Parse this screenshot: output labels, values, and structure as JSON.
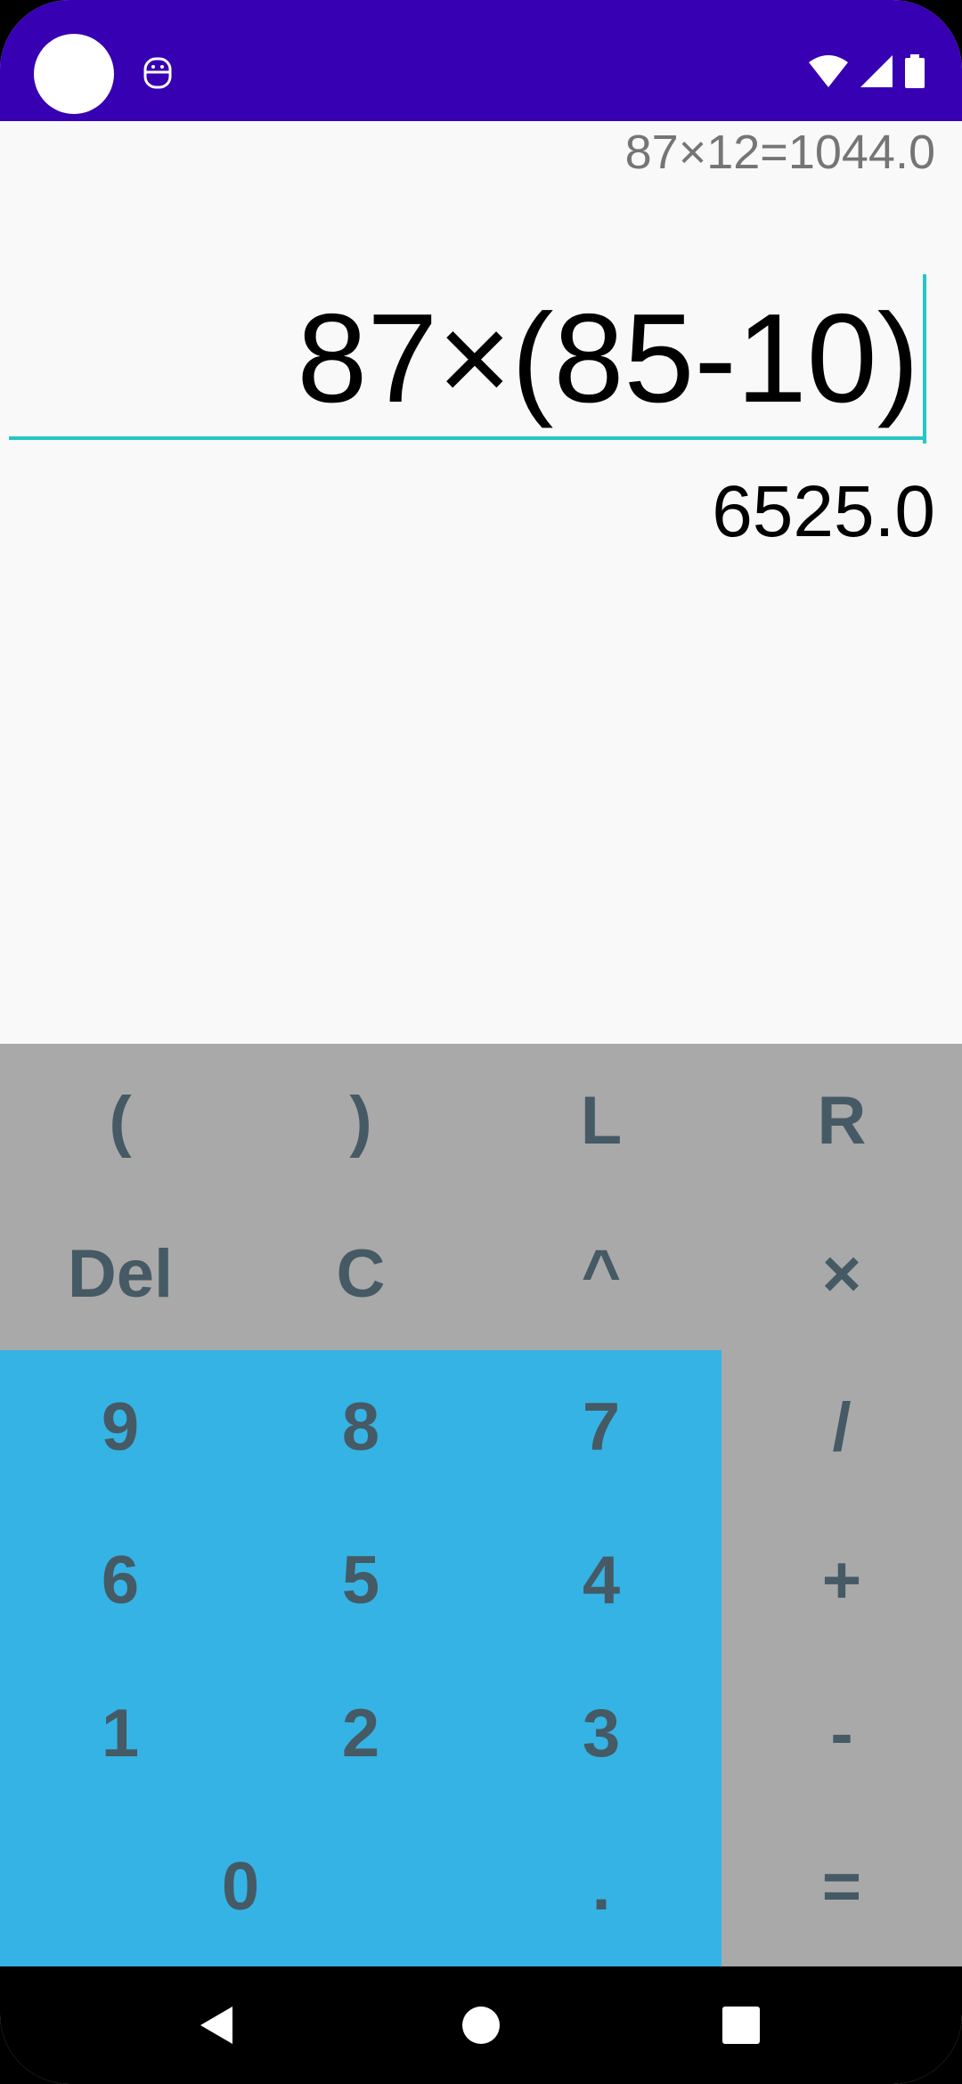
{
  "colors": {
    "status_bar": "#3700b3",
    "display_bg": "#f9f9f9",
    "keypad_bg": "#a9a9a9",
    "numpad_bg": "#35b3e4",
    "key_text": "#455a64",
    "accent": "#26c6c6"
  },
  "status_bar": {
    "icons": [
      "notification-circle",
      "app-icon",
      "wifi-icon",
      "signal-icon",
      "battery-icon"
    ]
  },
  "display": {
    "history": "87×12=1044.0",
    "expression": "87×(85-10)",
    "result": "6525.0"
  },
  "keypad": {
    "rows": [
      [
        "(",
        ")",
        "L",
        "R"
      ],
      [
        "Del",
        "C",
        "^",
        "×"
      ],
      [
        "9",
        "8",
        "7",
        "/"
      ],
      [
        "6",
        "5",
        "4",
        "+"
      ],
      [
        "1",
        "2",
        "3",
        "-"
      ],
      [
        "0",
        ".",
        "="
      ]
    ]
  },
  "nav_bar": {
    "icons": [
      "back-icon",
      "home-icon",
      "recents-icon"
    ]
  }
}
